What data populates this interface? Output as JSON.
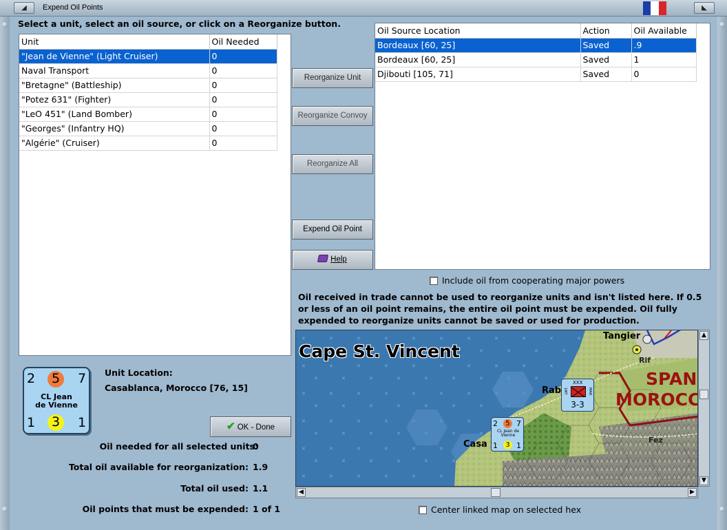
{
  "window": {
    "title": "Expend Oil Points"
  },
  "instruction": "Select a unit, select an oil source, or click on a Reorganize button.",
  "units_table": {
    "headers": [
      "Unit",
      "Oil Needed"
    ],
    "rows": [
      {
        "unit": "\"Jean de Vienne\" (Light Cruiser)",
        "oil": "0",
        "selected": true
      },
      {
        "unit": "Naval Transport",
        "oil": "0"
      },
      {
        "unit": "\"Bretagne\" (Battleship)",
        "oil": "0"
      },
      {
        "unit": "\"Potez 631\" (Fighter)",
        "oil": "0"
      },
      {
        "unit": "\"LeO 451\" (Land Bomber)",
        "oil": "0"
      },
      {
        "unit": "\"Georges\" (Infantry HQ)",
        "oil": "0"
      },
      {
        "unit": "\"Algérie\" (Cruiser)",
        "oil": "0"
      }
    ]
  },
  "sources_table": {
    "headers": [
      "Oil Source Location",
      "Action",
      "Oil Available"
    ],
    "rows": [
      {
        "loc": "Bordeaux [60, 25]",
        "action": "Saved",
        "avail": ".9",
        "selected": true
      },
      {
        "loc": "Bordeaux [60, 25]",
        "action": "Saved",
        "avail": "1"
      },
      {
        "loc": "Djibouti [105, 71]",
        "action": "Saved",
        "avail": "0"
      }
    ]
  },
  "buttons": {
    "reorganize_unit": "Reorganize Unit",
    "reorganize_convoy": "Reorganize Convoy",
    "reorganize_all": "Reorganize All",
    "expend_oil_point": "Expend Oil Point",
    "help": "Help",
    "ok_done": "OK - Done"
  },
  "include_oil_label": "Include oil from cooperating major powers",
  "oil_note": "Oil received in trade cannot be used to reorganize units and isn't listed here.  If 0.5 or less of an oil point remains, the entire oil point must be expended.   Oil fully expended to reorganize units cannot be saved or used for production.",
  "unit_counter": {
    "top_left": "2",
    "top_center": "5",
    "top_right": "7",
    "name_line1": "CL Jean",
    "name_line2": "de Vienne",
    "bottom_left": "1",
    "bottom_center": "3",
    "bottom_right": "1"
  },
  "unit_location": {
    "label": "Unit Location:",
    "value": "Casablanca, Morocco [76, 15]"
  },
  "stats": {
    "oil_needed_label": "Oil needed for all selected units:",
    "oil_needed_value": "0",
    "total_avail_label": "Total oil available for reorganization:",
    "total_avail_value": "1.9",
    "total_used_label": "Total oil used:",
    "total_used_value": "1.1",
    "must_expend_label": "Oil points that must be expended:",
    "must_expend_value": "1 of 1"
  },
  "map": {
    "sea_label": "Cape St. Vincent",
    "land_label1": "SPAN",
    "land_label2": "MOROCC",
    "cities": [
      "Tangier",
      "Rif",
      "Rab",
      "Casa",
      "Fez"
    ],
    "hq_counter": {
      "top": "XXX",
      "side_left": "1MT",
      "side_right": "MAR",
      "value": "3-3"
    },
    "mini_counter": {
      "tl": "2",
      "tc": "5",
      "tr": "7",
      "name": "CL Jean de Vienne",
      "bl": "1",
      "bc": "3",
      "br": "1"
    }
  },
  "center_map_label": "Center linked map on selected hex",
  "colors": {
    "selection": "#0a62d0",
    "background": "#9fb9cf",
    "attack_circle": "#f07a3c",
    "move_circle": "#f5f21a",
    "counter_blue": "#a9d4f2"
  }
}
